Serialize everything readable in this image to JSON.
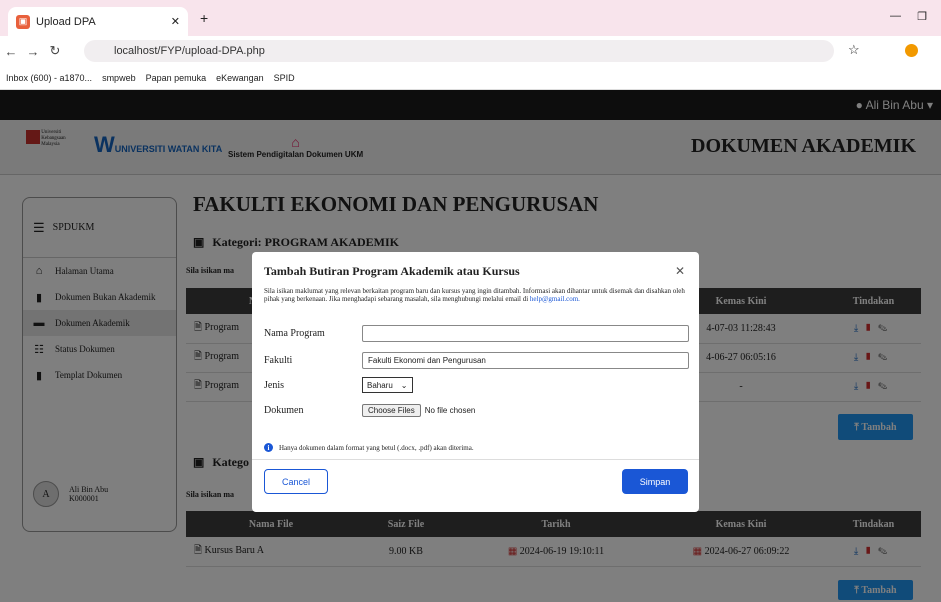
{
  "browser": {
    "tab_title": "Upload DPA",
    "url": "localhost/FYP/upload-DPA.php",
    "bookmarks": [
      "Inbox (600) - a1870...",
      "smpweb",
      "Papan pemuka",
      "eKewangan",
      "SPID"
    ]
  },
  "topbar": {
    "user": "Ali Bin Abu"
  },
  "header": {
    "title": "DOKUMEN AKADEMIK",
    "logo_univ": "Universiti Kebangsaan Malaysia",
    "logo_tagline": "UNIVERSITI WATAN KITA",
    "logo_system": "Sistem Pendigitalan Dokumen UKM"
  },
  "sidebar": {
    "brand": "SPDUKM",
    "items": [
      {
        "label": "Halaman Utama",
        "icon": "home-icon"
      },
      {
        "label": "Dokumen Bukan Akademik",
        "icon": "file-icon"
      },
      {
        "label": "Dokumen Akademik",
        "icon": "inbox-icon"
      },
      {
        "label": "Status Dokumen",
        "icon": "list-icon"
      },
      {
        "label": "Templat Dokumen",
        "icon": "clipboard-icon"
      }
    ],
    "user_name": "Ali Bin Abu",
    "user_id": "K000001",
    "avatar_initial": "A"
  },
  "main": {
    "title": "FAKULTI EKONOMI DAN PENGURUSAN",
    "cat1_label": "Kategori: PROGRAM AKADEMIK",
    "note": "Sila isikan ma",
    "cat2_label": "Katego",
    "headers": [
      "Nama File",
      "Saiz File",
      "Tarikh",
      "Kemas Kini",
      "Tindakan"
    ],
    "rows1": [
      {
        "name": "Program",
        "date": "4-07-03 11:28:43"
      },
      {
        "name": "Program",
        "date": "4-06-27 06:05:16"
      },
      {
        "name": "Program",
        "date": "-"
      }
    ],
    "rows2": [
      {
        "name": "Kursus Baru A",
        "size": "9.00 KB",
        "date": "2024-06-19 19:10:11",
        "updated": "2024-06-27 06:09:22"
      }
    ],
    "tambah_label": "Tambah"
  },
  "modal": {
    "title": "Tambah Butiran Program Akademik atau Kursus",
    "description": "Sila isikan maklumat yang relevan berkaitan program baru dan kursus yang ingin ditambah. Informasi akan dihantar untuk disemak dan disahkan oleh pihak yang berkenaan. Jika menghadapi sebarang masalah, sila menghubungi melalui email di ",
    "email": "help@gmail.com.",
    "fields": {
      "nama_label": "Nama Program",
      "nama_value": "",
      "fakulti_label": "Fakulti",
      "fakulti_value": "Fakulti Ekonomi dan Pengurusan",
      "jenis_label": "Jenis",
      "jenis_value": "Baharu",
      "dokumen_label": "Dokumen",
      "choose_label": "Choose Files",
      "no_file": "No file chosen"
    },
    "note": "Hanya dokumen dalam format yang betul (.docx, .pdf) akan diterima.",
    "cancel": "Cancel",
    "save": "Simpan"
  }
}
